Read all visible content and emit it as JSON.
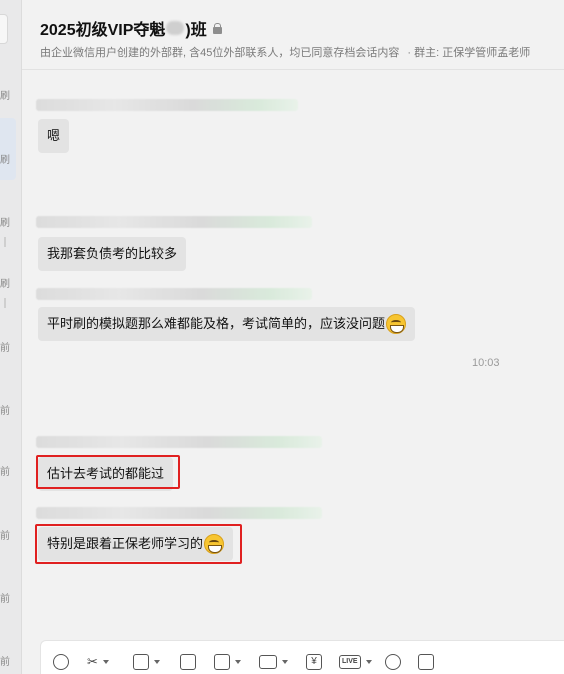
{
  "header": {
    "title_prefix": "2025初级VIP夺魁",
    "title_suffix": ")班",
    "subtitle": "由企业微信用户创建的外部群, 含45位外部联系人，均已同意存档会话内容",
    "owner": "· 群主: 正保学管师孟老师"
  },
  "rail": {
    "chars": [
      "刷",
      "刷",
      "刷",
      "刷",
      "前",
      "前",
      "前",
      "前",
      "前",
      "前"
    ]
  },
  "messages": [
    {
      "text": "嗯",
      "emoji": false,
      "highlighted": false
    },
    {
      "text": "我那套负债考的比较多",
      "emoji": false,
      "highlighted": false
    },
    {
      "text": "平时刷的模拟题那么难都能及格，考试简单的，应该没问题",
      "emoji": true,
      "highlighted": false
    },
    {
      "text": "估计去考试的都能过",
      "emoji": false,
      "highlighted": true
    },
    {
      "text": "特别是跟着正保老师学习的",
      "emoji": true,
      "highlighted": true
    }
  ],
  "timestamp": "10:03",
  "toolbar": {
    "icons": [
      "emoji-icon",
      "scissors-icon",
      "image-icon",
      "document-icon",
      "checklist-icon",
      "folder-icon",
      "payment-icon",
      "live-icon",
      "more-icon",
      "history-icon"
    ],
    "live_label": "LIVE",
    "yen_glyph": "¥"
  },
  "colors": {
    "highlight": "#e02020",
    "bubble": "#e3e3e3"
  }
}
